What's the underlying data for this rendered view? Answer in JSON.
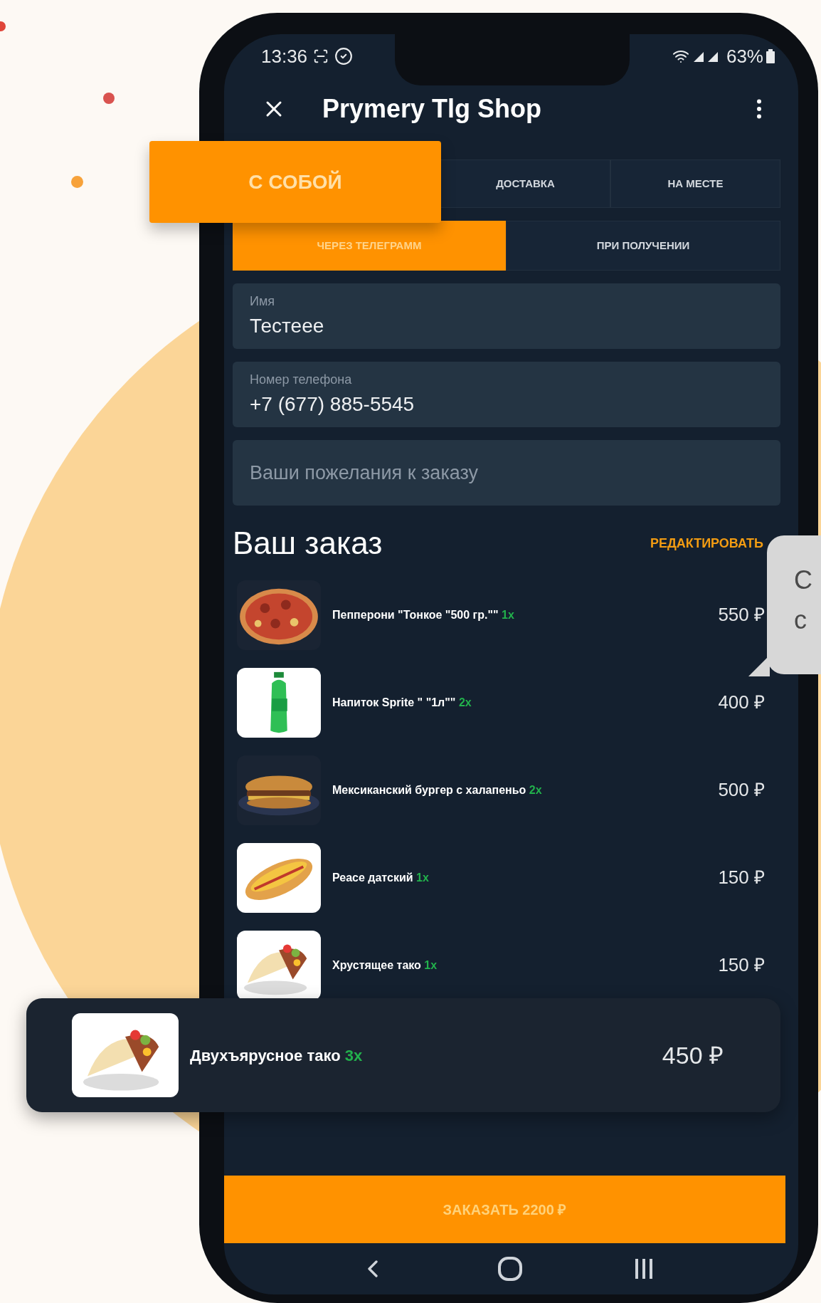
{
  "status_bar": {
    "time": "13:36",
    "battery": "63%"
  },
  "app_bar": {
    "title": "Prymery Tlg Shop"
  },
  "order_type_tabs": [
    {
      "label": "С СОБОЙ",
      "selected": true
    },
    {
      "label": "ДОСТАВКА",
      "selected": false
    },
    {
      "label": "НА МЕСТЕ",
      "selected": false
    }
  ],
  "payment_tabs": [
    {
      "label": "ЧЕРЕЗ ТЕЛЕГРАММ",
      "selected": true
    },
    {
      "label": "ПРИ ПОЛУЧЕНИИ",
      "selected": false
    }
  ],
  "fields": [
    {
      "label": "Имя",
      "value": "Тестеее"
    },
    {
      "label": "Номер телефона",
      "value": "+7 (677) 885-5545"
    },
    {
      "placeholder": "Ваши пожелания к заказу"
    }
  ],
  "order": {
    "heading": "Ваш заказ",
    "edit_link": "РЕДАКТИРОВАТЬ",
    "items": [
      {
        "name": "Пепперони \"Тонкое \"500 гр.\"\"",
        "quantity": "1x",
        "price": "550 ₽",
        "highlighted": false
      },
      {
        "name": "Напиток Sprite \" \"1л\"\"",
        "quantity": "2x",
        "price": "400 ₽",
        "highlighted": false
      },
      {
        "name": "Мексиканский бургер с халапеньо",
        "quantity": "2x",
        "price": "500 ₽",
        "highlighted": false
      },
      {
        "name": "Реасе датский",
        "quantity": "1x",
        "price": "150 ₽",
        "highlighted": false
      },
      {
        "name": "Хрустящее тако",
        "quantity": "1x",
        "price": "150 ₽",
        "highlighted": false
      },
      {
        "name": "Двухъярусное тако",
        "quantity": "3x",
        "price": "450 ₽",
        "highlighted": true
      }
    ]
  },
  "order_button": "ЗАКАЗАТЬ 2200 ₽",
  "speech_bubble": {
    "lines": [
      "С",
      "с"
    ]
  }
}
